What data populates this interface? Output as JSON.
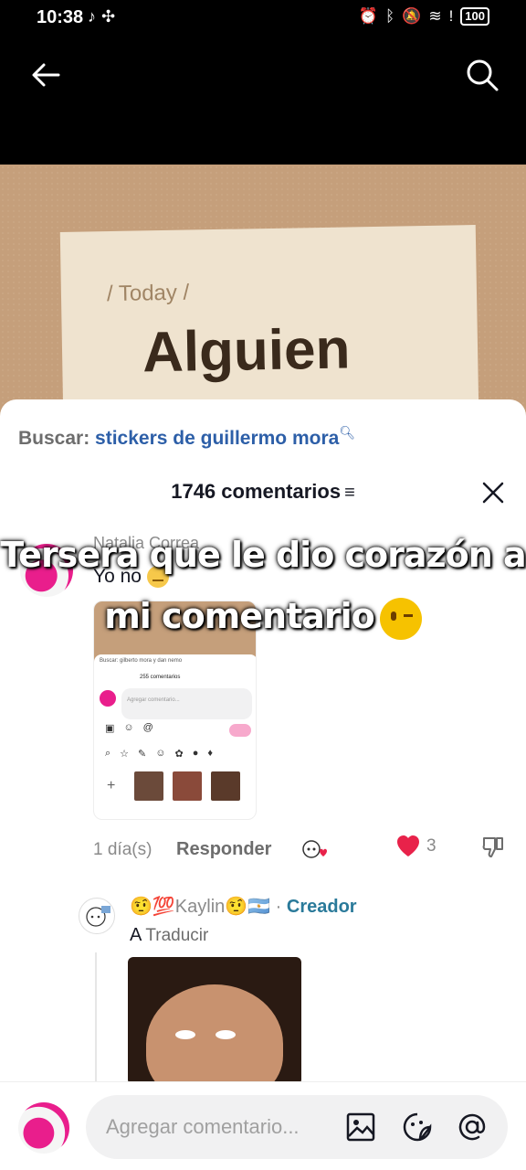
{
  "status_bar": {
    "time": "10:38",
    "battery": "100"
  },
  "video": {
    "tag": "/ Today /",
    "headline": "Alguien"
  },
  "sheet": {
    "search_label": "Buscar:",
    "search_term": "stickers de guillermo mora",
    "comment_count": "1746 comentarios",
    "filter_glyph": "≡"
  },
  "comment1": {
    "username": "Natalia Correa",
    "text": "Yo no",
    "time": "1 día(s)",
    "reply_label": "Responder",
    "like_count": "3",
    "thumb": {
      "search": "Buscar: gilberto mora y dan nemo",
      "count": "255 comentarios",
      "input": "Agregar comentario..."
    }
  },
  "comment2": {
    "username": "🤨💯Kaylin🤨🇦🇷",
    "separator": "·",
    "creator_label": "Creador",
    "translate_glyph": "A",
    "translate_label": "Traducir"
  },
  "bottom_bar": {
    "placeholder": "Agregar comentario..."
  },
  "caption": {
    "line1": "Tersera que le dio corazón a",
    "line2": "mi comentario"
  },
  "colors": {
    "accent_blue": "#2d5fa8",
    "like_red": "#e8224a",
    "creator_teal": "#2a7a9a",
    "avatar_pink": "#e91e8c"
  },
  "icons": [
    "back-arrow-icon",
    "search-icon",
    "close-icon",
    "heart-icon",
    "dislike-icon",
    "image-icon",
    "sticker-icon",
    "mention-icon"
  ]
}
